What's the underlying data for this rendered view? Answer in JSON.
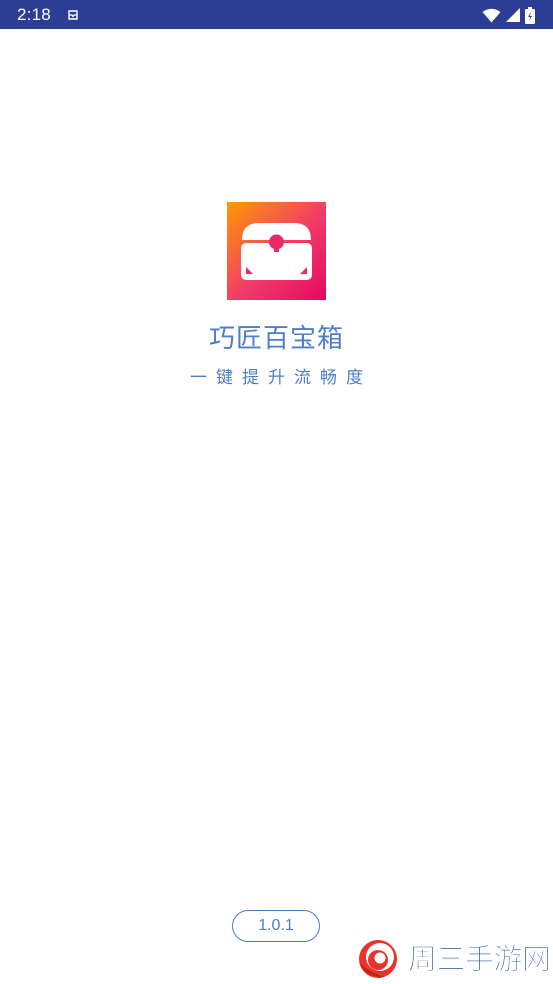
{
  "status_bar": {
    "time": "2:18",
    "background": "#2c3e93",
    "icons": [
      "notification-icon",
      "wifi-icon",
      "signal-icon",
      "battery-icon"
    ]
  },
  "splash": {
    "logo_icon": "treasure-chest-icon",
    "app_name": "巧匠百宝箱",
    "slogan": "一键提升流畅度",
    "version": "1.0.1",
    "accent_color": "#4c7ec9",
    "logo_gradient": [
      "#ff8a00",
      "#e8175d"
    ]
  },
  "watermark": {
    "text": "周三手游网",
    "logo_icon": "spiral-logo-icon",
    "colors": [
      "#e8322b",
      "#1a4b8f"
    ]
  }
}
